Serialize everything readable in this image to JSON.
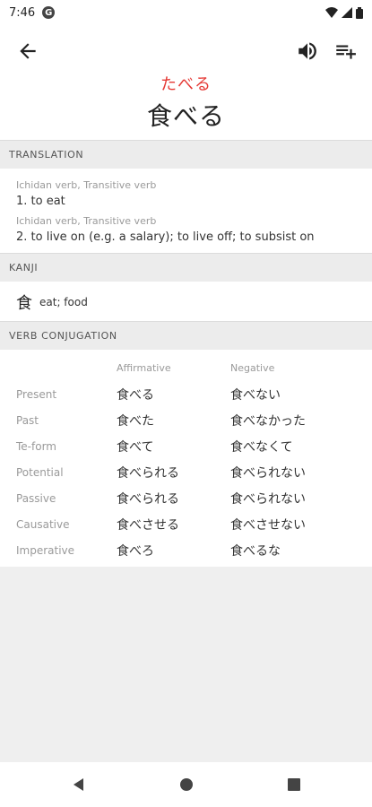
{
  "status": {
    "time": "7:46",
    "g_icon": "G"
  },
  "header": {
    "reading": "たべる",
    "word": "食べる"
  },
  "translation": {
    "title": "TRANSLATION",
    "senses": [
      {
        "pos": "Ichidan verb, Transitive verb",
        "meaning": "1. to eat"
      },
      {
        "pos": "Ichidan verb, Transitive verb",
        "meaning": "2. to live on (e.g. a salary); to live off; to subsist on"
      }
    ]
  },
  "kanji": {
    "title": "KANJI",
    "items": [
      {
        "char": "食",
        "meaning": "eat; food"
      }
    ]
  },
  "conjugation": {
    "title": "VERB CONJUGATION",
    "affirmative_label": "Affirmative",
    "negative_label": "Negative",
    "rows": [
      {
        "form": "Present",
        "affirmative": "食べる",
        "negative": "食べない"
      },
      {
        "form": "Past",
        "affirmative": "食べた",
        "negative": "食べなかった"
      },
      {
        "form": "Te-form",
        "affirmative": "食べて",
        "negative": "食べなくて"
      },
      {
        "form": "Potential",
        "affirmative": "食べられる",
        "negative": "食べられない"
      },
      {
        "form": "Passive",
        "affirmative": "食べられる",
        "negative": "食べられない"
      },
      {
        "form": "Causative",
        "affirmative": "食べさせる",
        "negative": "食べさせない"
      },
      {
        "form": "Imperative",
        "affirmative": "食べろ",
        "negative": "食べるな"
      }
    ]
  },
  "icons": {
    "back": "back-arrow-icon",
    "speaker": "speaker-icon",
    "add_list": "playlist-add-icon",
    "nav_back": "nav-back-triangle-icon",
    "nav_home": "nav-home-circle-icon",
    "nav_recents": "nav-recents-square-icon"
  },
  "colors": {
    "reading": "#e53935",
    "section_header_bg": "#ececec",
    "page_bg": "#efefef"
  }
}
